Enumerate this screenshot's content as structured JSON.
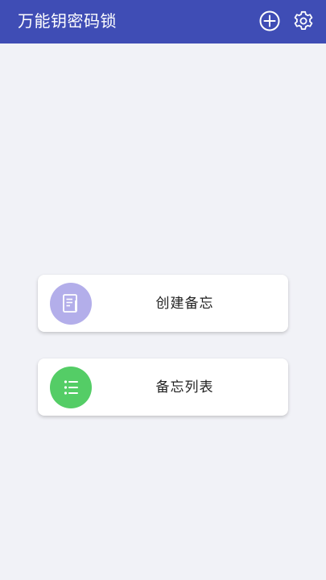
{
  "header": {
    "title": "万能钥密码锁",
    "background": "#3f4db5",
    "actions": [
      {
        "icon": "plus-circle-icon"
      },
      {
        "icon": "gear-icon"
      }
    ]
  },
  "main": {
    "background": "#f1f2f7",
    "cards": [
      {
        "label": "创建备忘",
        "icon": "note-edit-icon",
        "icon_color": "#b3aeea"
      },
      {
        "label": "备忘列表",
        "icon": "list-icon",
        "icon_color": "#54cd66"
      }
    ]
  }
}
